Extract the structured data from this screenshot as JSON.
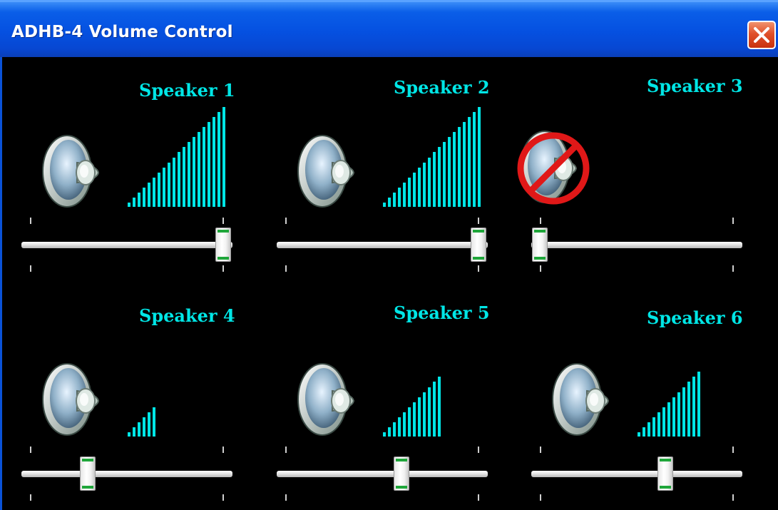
{
  "window": {
    "title": "ADHB-4 Volume Control",
    "close_icon": "close-x-icon"
  },
  "colors": {
    "label": "#00e6e6",
    "bars": "#00e6e6",
    "titlebar": "#0550e0",
    "mute_sign": "#e01818"
  },
  "speakers": [
    {
      "label": "Speaker 1",
      "volume_fraction": 1.0,
      "muted": false,
      "icon": "speaker-icon"
    },
    {
      "label": "Speaker 2",
      "volume_fraction": 1.0,
      "muted": false,
      "icon": "speaker-icon"
    },
    {
      "label": "Speaker 3",
      "volume_fraction": 0.0,
      "muted": true,
      "icon": "muted-speaker-icon"
    },
    {
      "label": "Speaker 4",
      "volume_fraction": 0.3,
      "muted": false,
      "icon": "speaker-icon"
    },
    {
      "label": "Speaker 5",
      "volume_fraction": 0.6,
      "muted": false,
      "icon": "speaker-icon"
    },
    {
      "label": "Speaker 6",
      "volume_fraction": 0.65,
      "muted": false,
      "icon": "speaker-icon"
    }
  ]
}
